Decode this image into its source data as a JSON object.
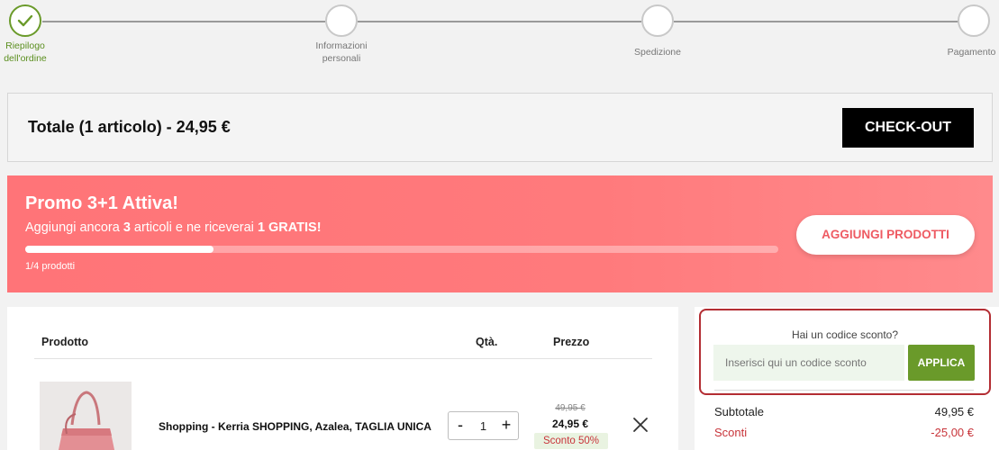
{
  "stepper": {
    "steps": [
      {
        "label_line1": "Riepilogo",
        "label_line2": "dell'ordine",
        "state": "done"
      },
      {
        "label_line1": "Informazioni",
        "label_line2": "personali",
        "state": "todo"
      },
      {
        "label_line1": "Spedizione",
        "label_line2": "",
        "state": "todo"
      },
      {
        "label_line1": "Pagamento",
        "label_line2": "",
        "state": "todo"
      }
    ]
  },
  "total_bar": {
    "total_text": "Totale (1 articolo) - 24,95 €",
    "checkout_label": "CHECK-OUT"
  },
  "promo": {
    "title": "Promo 3+1 Attiva!",
    "sub_prefix": "Aggiungi ancora ",
    "sub_count": "3",
    "sub_middle": " articoli e ne riceverai ",
    "sub_free": "1 GRATIS!",
    "progress_fraction": 0.25,
    "progress_label": "1/4 prodotti",
    "add_button": "AGGIUNGI PRODOTTI"
  },
  "cart": {
    "headers": {
      "product": "Prodotto",
      "qty": "Qtà.",
      "price": "Prezzo"
    },
    "items": [
      {
        "name": "Shopping - Kerria SHOPPING, Azalea, TAGLIA UNICA",
        "qty": "1",
        "qty_minus": "-",
        "qty_plus": "+",
        "old_price": "49,95 €",
        "price": "24,95 €",
        "discount": "Sconto 50%"
      }
    ]
  },
  "summary": {
    "coupon_question": "Hai un codice sconto?",
    "coupon_placeholder": "Inserisci qui un codice sconto",
    "apply_label": "APPLICA",
    "subtotal_label": "Subtotale",
    "subtotal_value": "49,95 €",
    "discount_label": "Sconti",
    "discount_value": "-25,00 €"
  },
  "colors": {
    "accent_green": "#6a9a2a",
    "promo_red": "#ff7478",
    "discount_red": "#c8343a"
  }
}
